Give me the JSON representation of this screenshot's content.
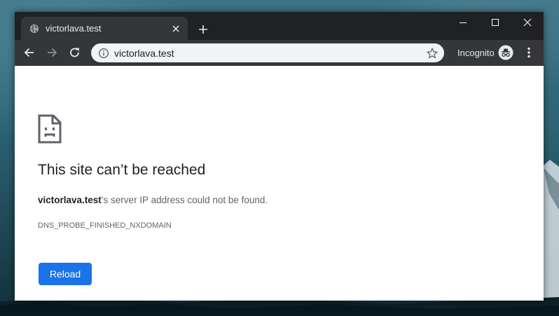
{
  "colors": {
    "tabstrip": "#202124",
    "toolbar": "#35363a",
    "omnibox": "#f1f3f4",
    "reload_button": "#1a73e8"
  },
  "tab": {
    "title": "victorlava.test",
    "favicon": "globe-icon",
    "close_icon": "close-icon"
  },
  "window_controls": [
    "minimize-icon",
    "maximize-icon",
    "close-icon"
  ],
  "toolbar": {
    "back_icon": "back-arrow-icon",
    "forward_icon": "forward-arrow-icon",
    "reload_icon": "reload-icon",
    "url": "victorlava.test",
    "incognito_label": "Incognito",
    "incognito_icon": "incognito-icon",
    "menu_icon": "kebab-menu-icon"
  },
  "error": {
    "icon": "sad-page-icon",
    "title": "This site can’t be reached",
    "host": "victorlava.test",
    "message_rest": "’s server IP address could not be found.",
    "code": "DNS_PROBE_FINISHED_NXDOMAIN",
    "reload_label": "Reload"
  }
}
